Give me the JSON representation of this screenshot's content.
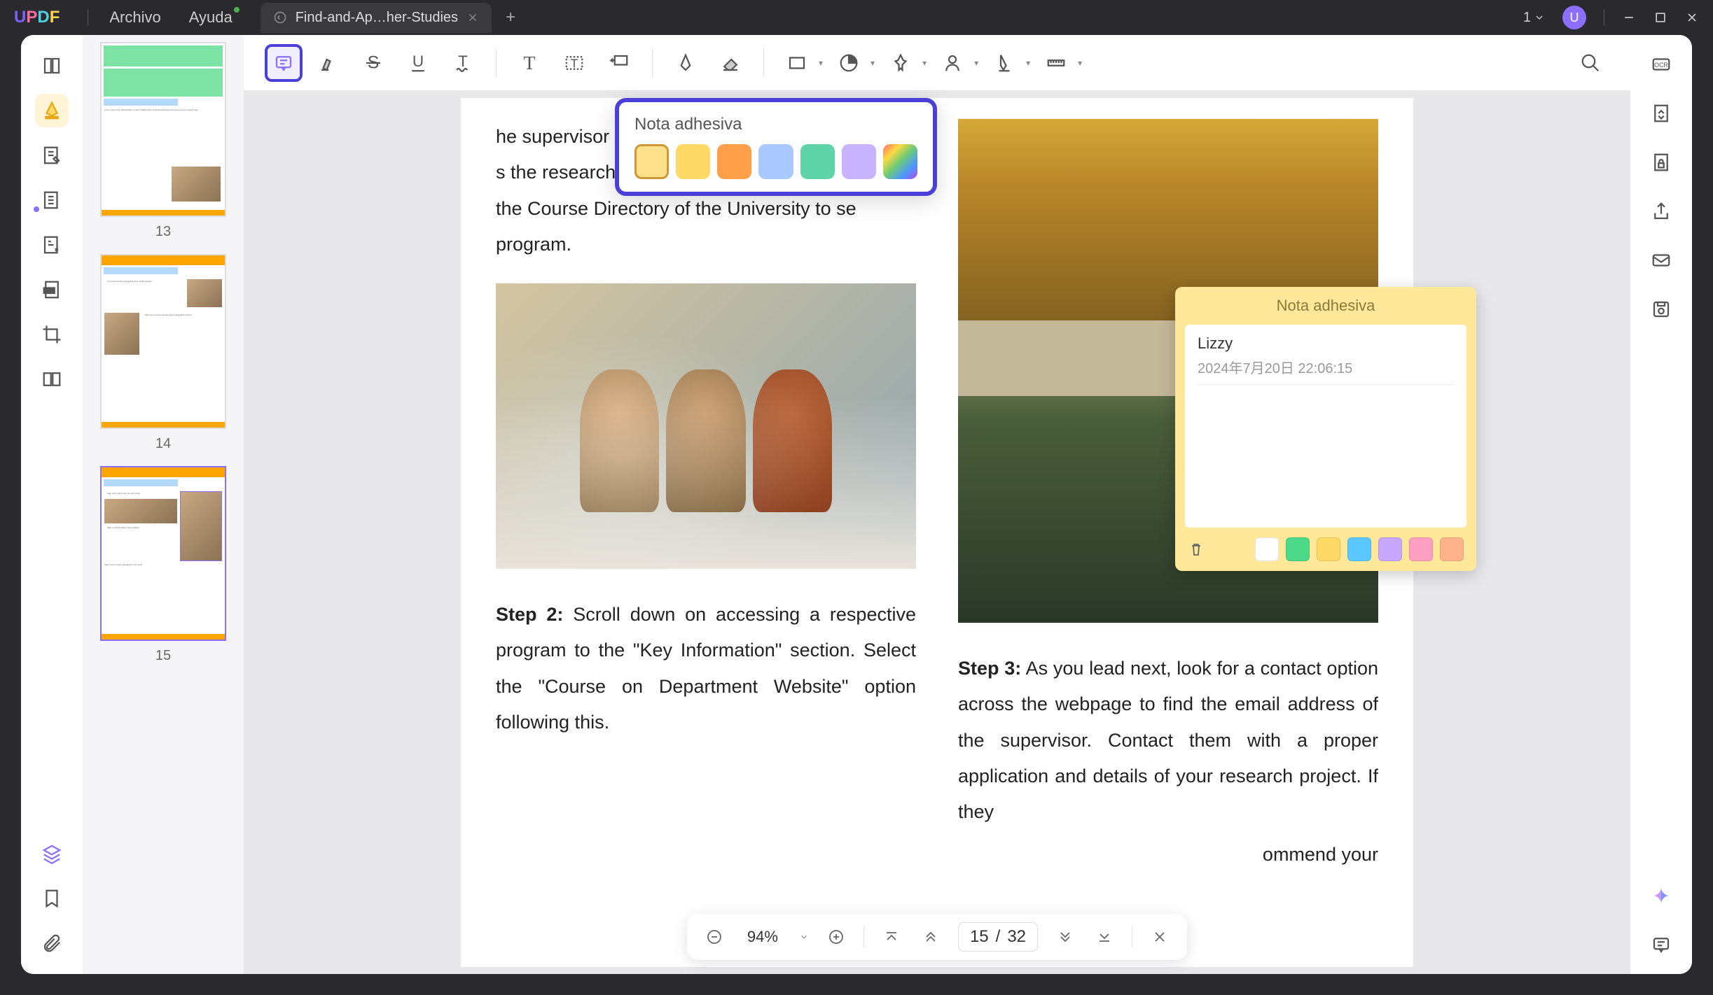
{
  "menu": {
    "archivo": "Archivo",
    "ayuda": "Ayuda"
  },
  "tab": {
    "title": "Find-and-Ap…her-Studies"
  },
  "window_count": "1",
  "avatar_letter": "U",
  "thumbs": [
    {
      "num": "13"
    },
    {
      "num": "14"
    },
    {
      "num": "15"
    }
  ],
  "color_popup": {
    "title": "Nota adhesiva",
    "colors": [
      "#ffe08a",
      "#ffd966",
      "#ff9f4a",
      "#a8c8ff",
      "#5fd4a8",
      "#c8b3ff",
      "linear-gradient(135deg,#ff6b6b,#ffd93d,#6bcb77,#4d96ff,#b14aed)"
    ]
  },
  "doc": {
    "p1": "he supervisor and connect with s the research project. Go across the Course Directory of the University to se program.",
    "p1_partial_1": "he supervisor and connect with",
    "p1_partial_2": "s the research project. Go across",
    "p1_partial_3": "the Course Directory of the University to se",
    "p1_partial_4": "program.",
    "step2_label": "Step 2:",
    "step2_text": " Scroll down on accessing a respective program to the \"Key Information\" section. Select the \"Course on Department Website\" option following this.",
    "step3_label": "Step 3:",
    "step3_text": " As you lead next, look for a contact option across the webpage to find the email address of the supervisor. Contact them with a proper application and details of your research project. If they",
    "step3_tail": "ommend your"
  },
  "sticky": {
    "title": "Nota adhesiva",
    "author": "Lizzy",
    "date": "2024年7月20日 22:06:15",
    "colors": [
      "#ffffff",
      "#4cd98a",
      "#ffd966",
      "#5ac8ff",
      "#c8a8ff",
      "#ff9fc2",
      "#ffb38a"
    ]
  },
  "pager": {
    "zoom": "94%",
    "page": "15",
    "sep": "/",
    "total": "32"
  }
}
